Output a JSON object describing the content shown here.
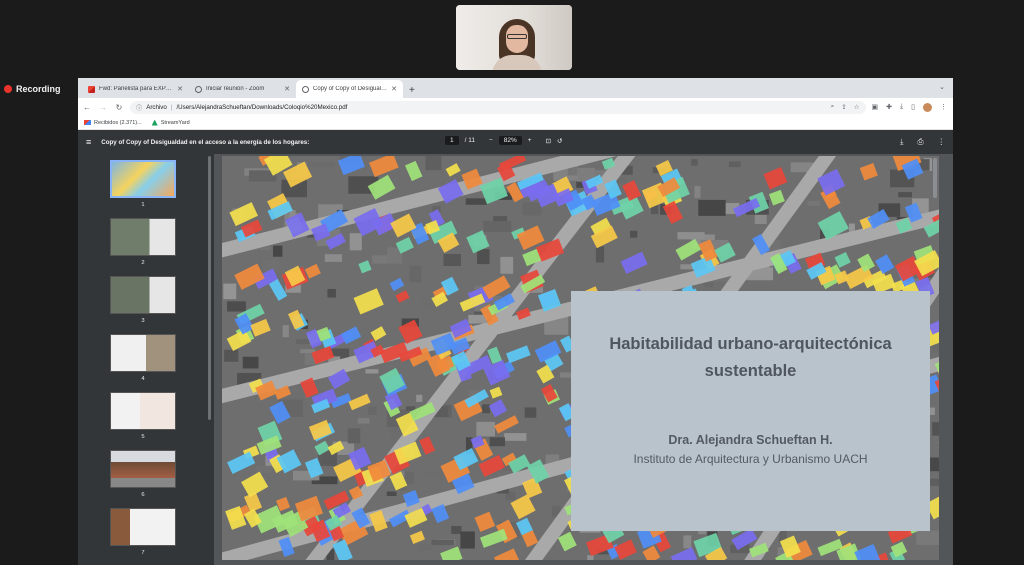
{
  "recording": {
    "label": "Recording"
  },
  "tabs": [
    {
      "label": "Fwd: Panelista para EXPLORA",
      "icon": "gmail-icon",
      "active": false
    },
    {
      "label": "Iniciar reunión - Zoom",
      "icon": "globe-icon",
      "active": false
    },
    {
      "label": "Copy of Copy of Desigualdad",
      "icon": "globe-icon",
      "active": true
    }
  ],
  "address": {
    "prefix": "Archivo",
    "url": "/Users/AlejandraSchueftan/Downloads/Coloqio%20Mexico.pdf"
  },
  "bookmarks": [
    {
      "label": "Recibidos (2.371)...",
      "icon": "gmail-icon"
    },
    {
      "label": "StreamYard",
      "icon": "streamyard-icon"
    }
  ],
  "pdf": {
    "title": "Copy of Copy of Desigualdad en el acceso a la energía de los hogares:",
    "page_current": "1",
    "page_total": "/ 11",
    "zoom": "82%"
  },
  "thumbnails": [
    "1",
    "2",
    "3",
    "4",
    "5",
    "6",
    "7"
  ],
  "slide": {
    "title": "Habitabilidad urbano-arquitectónica sustentable",
    "author": "Dra. Alejandra Schueftan H.",
    "institution": "Instituto de Arquitectura y Urbanismo UACH"
  },
  "colors": {
    "accent": "#8ab4f8",
    "recording": "#e8342c",
    "card": "#b9c3cc"
  }
}
